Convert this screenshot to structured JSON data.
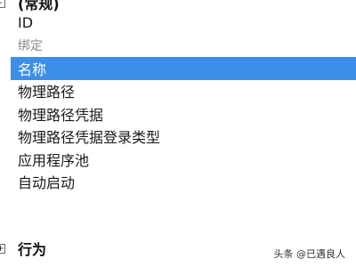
{
  "groups": {
    "top": {
      "label": "(常规)",
      "toggle": "-"
    },
    "bottom": {
      "label": "行为",
      "toggle": "+"
    }
  },
  "properties": [
    {
      "label": "ID",
      "state": "normal"
    },
    {
      "label": "绑定",
      "state": "disabled"
    },
    {
      "label": "名称",
      "state": "selected"
    },
    {
      "label": "物理路径",
      "state": "normal"
    },
    {
      "label": "物理路径凭据",
      "state": "normal"
    },
    {
      "label": "物理路径凭据登录类型",
      "state": "normal"
    },
    {
      "label": "应用程序池",
      "state": "normal"
    },
    {
      "label": "自动启动",
      "state": "normal"
    }
  ],
  "watermark": "头条 @已遇良人",
  "colors": {
    "selection": "#3c8fe6",
    "disabled_text": "#8a8a8a"
  }
}
